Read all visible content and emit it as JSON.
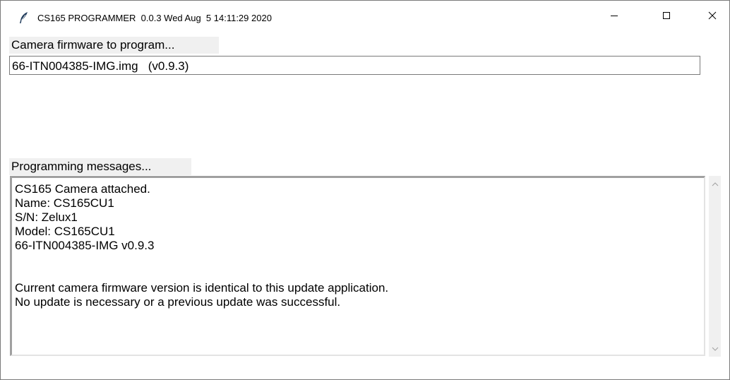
{
  "window": {
    "title": "CS165 PROGRAMMER  0.0.3 Wed Aug  5 14:11:29 2020",
    "icon": "feather-icon",
    "controls": {
      "minimize_icon": "minimize-icon",
      "maximize_icon": "maximize-icon",
      "close_icon": "close-icon"
    }
  },
  "firmware": {
    "label": "Camera firmware to program...",
    "value": "66-ITN004385-IMG.img   (v0.9.3)"
  },
  "messages": {
    "label": "Programming messages...",
    "lines": [
      "CS165 Camera attached.",
      "Name: CS165CU1",
      "S/N: Zelux1",
      "Model: CS165CU1",
      "66-ITN004385-IMG v0.9.3",
      "",
      "",
      "Current camera firmware version is identical to this update application.",
      "No update is necessary or a previous update was successful."
    ]
  },
  "colors": {
    "label_background": "#f0f0f0",
    "border": "#7a7a7a"
  }
}
